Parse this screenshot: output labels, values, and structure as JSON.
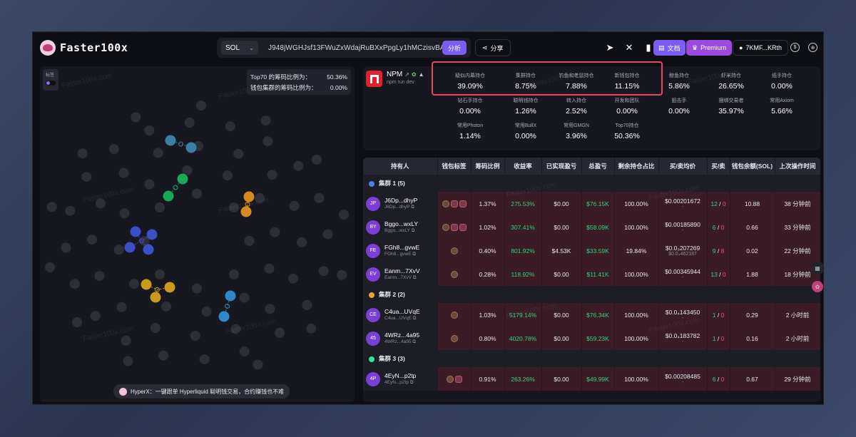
{
  "header": {
    "logo_text": "Faster100x",
    "chain": "SOL",
    "address": "J948jWGHJsf13FWuZxWdajRuBXxPpgLy1hMCzisvBAGS",
    "analyze": "分析",
    "share": "分享",
    "docs": "文档",
    "premium": "Premium",
    "user": "7KMF...KRth"
  },
  "graph": {
    "label_toggle": "标签",
    "ratio_top70_label": "Top70 的筹码比例为：",
    "ratio_top70_value": "50.36%",
    "ratio_cluster_label": "钱包集群的筹码比例为：",
    "ratio_cluster_value": "0.00%",
    "hyperx": "HyperX：一键跟单 Hyperliquid 聪明钱交易，合约赚钱也不难"
  },
  "token": {
    "name": "NPM",
    "sub": "npm run dev",
    "stats": [
      {
        "label": "疑似内幕持仓",
        "value": "39.09%"
      },
      {
        "label": "集群持仓",
        "value": "8.75%"
      },
      {
        "label": "钓鱼和老鼠持仓",
        "value": "7.88%"
      },
      {
        "label": "新钱包持仓",
        "value": "11.15%"
      },
      {
        "label": "鲸鱼持仓",
        "value": "5.86%"
      },
      {
        "label": "虾米持仓",
        "value": "26.65%"
      },
      {
        "label": "纸手持仓",
        "value": "0.00%"
      },
      {
        "label": "钻石手持仓",
        "value": "0.00%"
      },
      {
        "label": "聪明钱持仓",
        "value": "1.26%"
      },
      {
        "label": "转入持仓",
        "value": "2.52%"
      },
      {
        "label": "开发和团队",
        "value": "0.00%"
      },
      {
        "label": "狙击手",
        "value": "0.00%"
      },
      {
        "label": "捆绑交易者",
        "value": "35.97%"
      },
      {
        "label": "常用Axiom",
        "value": "5.66%"
      },
      {
        "label": "常用Photon",
        "value": "1.14%"
      },
      {
        "label": "常用BullX",
        "value": "0.00%"
      },
      {
        "label": "常用GMGN",
        "value": "3.96%"
      },
      {
        "label": "Top70持仓",
        "value": "50.36%"
      }
    ]
  },
  "table": {
    "headers": [
      "持有人",
      "钱包标签",
      "筹码比例",
      "收益率",
      "已实现盈亏",
      "总盈亏",
      "剩余持仓占比",
      "买/卖均价",
      "买/卖",
      "钱包余额(SOL)",
      "上次操作时间"
    ],
    "groups": [
      {
        "label": "集群 1 (5)",
        "color": "#4f7cf0",
        "rows": [
          {
            "av": "JP",
            "name": "J6Dp...dhyP",
            "sub": "J6Dp...dhyP",
            "tags": 3,
            "ratio": "1.37%",
            "roi": "275.53%",
            "realized": "$0.00",
            "total": "$76.15K",
            "remain": "100.00%",
            "price": "$0.00201672",
            "price_sub": "-",
            "buy": "12",
            "sell": "0",
            "bal": "10.88",
            "time": "38 分钟前"
          },
          {
            "av": "BY",
            "name": "Bggo...wxLY",
            "sub": "Bggo...wxLY",
            "tags": 3,
            "ratio": "1.02%",
            "roi": "307.41%",
            "realized": "$0.00",
            "total": "$58.09K",
            "remain": "100.00%",
            "price": "$0.00185890",
            "price_sub": "-",
            "buy": "6",
            "sell": "0",
            "bal": "0.66",
            "time": "33 分钟前"
          },
          {
            "av": "FE",
            "name": "FGh8...gvwE",
            "sub": "FGh8...gvwE",
            "tags": 1,
            "ratio": "0.40%",
            "roi": "801.92%",
            "realized": "$4.53K",
            "total": "$33.59K",
            "remain": "19.84%",
            "price": "$0.0₃207269",
            "price_sub": "$0.0₄462187",
            "buy": "9",
            "sell": "8",
            "bal": "0.02",
            "time": "22 分钟前"
          },
          {
            "av": "EV",
            "name": "Eanm...7XvV",
            "sub": "Eanm...7XvV",
            "tags": 1,
            "ratio": "0.28%",
            "roi": "118.92%",
            "realized": "$0.00",
            "total": "$11.41K",
            "remain": "100.00%",
            "price": "$0.00345944",
            "price_sub": "-",
            "buy": "13",
            "sell": "0",
            "bal": "1.88",
            "time": "18 分钟前"
          }
        ]
      },
      {
        "label": "集群 2 (2)",
        "color": "#f0a030",
        "rows": [
          {
            "av": "CE",
            "name": "C4ua...UVqE",
            "sub": "C4ua...UVqE",
            "tags": 1,
            "ratio": "1.03%",
            "roi": "5179.14%",
            "realized": "$0.00",
            "total": "$76.34K",
            "remain": "100.00%",
            "price": "$0.0₄143450",
            "price_sub": "-",
            "buy": "1",
            "sell": "0",
            "bal": "0.29",
            "time": "2 小时前"
          },
          {
            "av": "45",
            "name": "4WRz...4a95",
            "sub": "4WRz...4a95",
            "tags": 1,
            "ratio": "0.80%",
            "roi": "4020.78%",
            "realized": "$0.00",
            "total": "$59.23K",
            "remain": "100.00%",
            "price": "$0.0₄183782",
            "price_sub": "-",
            "buy": "1",
            "sell": "0",
            "bal": "0.16",
            "time": "2 小时前"
          }
        ]
      },
      {
        "label": "集群 3 (3)",
        "color": "#2ee6a0",
        "rows": [
          {
            "av": "4P",
            "name": "4EyN...p2tp",
            "sub": "4EyN...p2tp",
            "tags": 2,
            "ratio": "0.91%",
            "roi": "263.26%",
            "realized": "$0.00",
            "total": "$49.99K",
            "remain": "100.00%",
            "price": "$0.00208485",
            "price_sub": "-",
            "buy": "6",
            "sell": "0",
            "bal": "0.67",
            "time": "29 分钟前"
          }
        ]
      }
    ]
  },
  "watermark": "Faster100x.com",
  "colors": {
    "accent": "#7b5cf5",
    "highlight": "#e5485f",
    "green": "#36d27b",
    "red": "#ff4d5e"
  }
}
